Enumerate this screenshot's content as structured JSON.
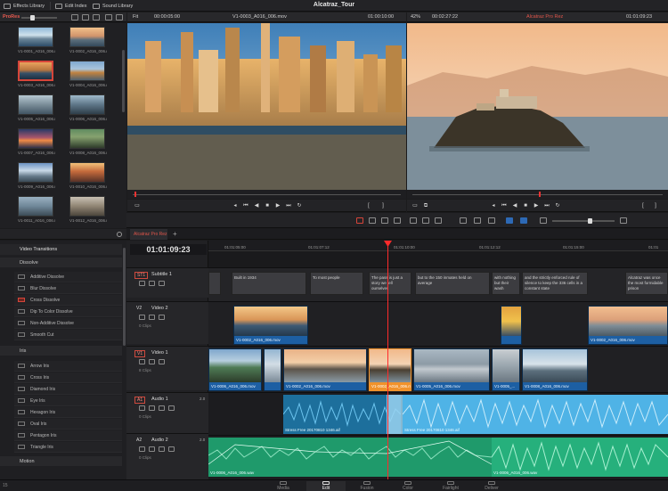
{
  "app_title": "Alcatraz_Tour",
  "top_tabs": [
    "Effects Library",
    "Edit Index",
    "Sound Library"
  ],
  "media_pool": {
    "label": "ProRes",
    "clips": [
      "V1-0001_A016_006.mov",
      "V1-0002_A016_006.mov",
      "V1-0003_A016_006.mov",
      "V1-0004_A016_006.mov",
      "V1-0005_A016_006.mov",
      "V1-0006_A016_006.mov",
      "V1-0007_A016_006.mov",
      "V1-0008_A016_006.mov",
      "V1-0009_A016_006.mov",
      "V1-0010_A016_006.mov",
      "V1-0011_A016_006.mov",
      "V1-0012_A016_006.mov"
    ]
  },
  "source_viewer": {
    "fit": "Fit",
    "duration": "00:00:05:00",
    "clip_name": "V1-0003_A016_006.mov",
    "timecode": "01:00:10:00"
  },
  "timeline_viewer": {
    "zoom": "42%",
    "duration": "00:02:27:22",
    "timeline_name": "Alcatraz Pro Rez",
    "timecode": "01:01:09:23"
  },
  "effects": {
    "header": "Video Transitions",
    "groups": [
      {
        "name": "Dissolve",
        "items": [
          "Additive Dissolve",
          "Blur Dissolve",
          "Cross Dissolve",
          "Dip To Color Dissolve",
          "Non-Additive Dissolve",
          "Smooth Cut"
        ]
      },
      {
        "name": "Iris",
        "items": [
          "Arrow Iris",
          "Cross Iris",
          "Diamond Iris",
          "Eye Iris",
          "Hexagon Iris",
          "Oval Iris",
          "Pentagon Iris",
          "Triangle Iris"
        ]
      },
      {
        "name": "Motion",
        "items": []
      }
    ]
  },
  "timeline": {
    "tab": "Alcatraz Pro Rez",
    "timecode": "01:01:09:23",
    "ruler": [
      "01:01:05:00",
      "01:01:07:12",
      "01:01:10:00",
      "01:01:12:12",
      "01:01:15:00",
      "01:01"
    ],
    "tracks": [
      {
        "id": "ST1",
        "name": "Subtitle 1",
        "count": ""
      },
      {
        "id": "V2",
        "name": "Video 2",
        "count": "0 Clips"
      },
      {
        "id": "V1",
        "name": "Video 1",
        "count": "8 Clips"
      },
      {
        "id": "A1",
        "name": "Audio 1",
        "value": "2.0",
        "count": "0 Clips"
      },
      {
        "id": "A2",
        "name": "Audio 2",
        "value": "2.0",
        "count": "0 Clips"
      }
    ],
    "subtitles": [
      "Built in 1934",
      "To most people",
      "The pass is just a story we tell ourselves",
      "but to the 150 inmates held on average",
      "with nothing but their wash",
      "and the strictly enforced rule of silence to keep the 336 cells in a constant state",
      "Alcatraz was once the most formidable prison"
    ],
    "v2_clips": [
      "V1-0002_A016_006.mov",
      "V1-0002_A016_006.mov"
    ],
    "v1_clips": [
      "V1-0006_A016_006.mov",
      "V1-0002_A016_006.mov",
      "V1-0002_A016_006.mov",
      "V1-0005_A016_006.mov",
      "V1-0005_...",
      "V1-0008_A016_006.mov"
    ],
    "a1_clips": [
      "Stress Free 20170810 1346.aif",
      "Stress Free 20170810 1346.aif"
    ],
    "a2_clips": [
      "V1-0006_A016_006.wav",
      "V1-0006_A016_006.wav"
    ]
  },
  "pages": [
    "Media",
    "Edit",
    "Fusion",
    "Color",
    "Fairlight",
    "Deliver"
  ],
  "active_page": "Edit",
  "version": "15"
}
